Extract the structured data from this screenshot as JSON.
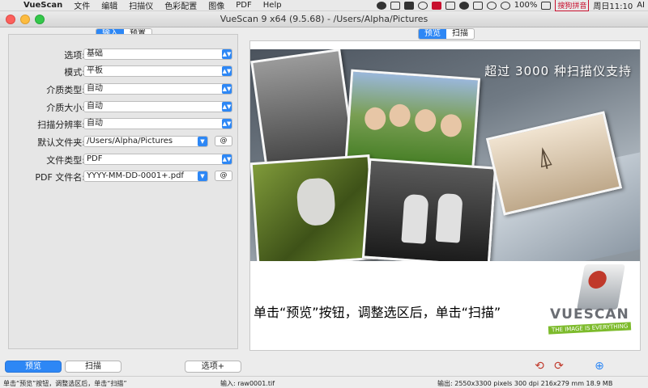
{
  "menubar": {
    "app_name": "VueScan",
    "items": [
      "文件",
      "编辑",
      "扫描仪",
      "色彩配置",
      "图像",
      "PDF",
      "Help"
    ],
    "battery": "100%",
    "ime": "搜狗拼音",
    "clock": "周日11:10",
    "tray_text": "AI"
  },
  "window": {
    "title": "VueScan 9 x64 (9.5.68) - /Users/Alpha/Pictures"
  },
  "left_tabs": [
    {
      "label": "输入",
      "active": true
    },
    {
      "label": "预置",
      "active": false
    }
  ],
  "fields": {
    "option": {
      "label": "选项:",
      "value": "基础"
    },
    "mode": {
      "label": "模式:",
      "value": "平板"
    },
    "media_type": {
      "label": "介质类型:",
      "value": "自动"
    },
    "media_size": {
      "label": "介质大小:",
      "value": "自动"
    },
    "resolution": {
      "label": "扫描分辨率:",
      "value": "自动"
    },
    "default_folder": {
      "label": "默认文件夹:",
      "value": "/Users/Alpha/Pictures",
      "at_label": "@"
    },
    "file_type": {
      "label": "文件类型:",
      "value": "PDF"
    },
    "pdf_name": {
      "label": "PDF 文件名:",
      "value": "YYYY-MM-DD-0001+.pdf",
      "at_label": "@"
    }
  },
  "right_tabs": [
    {
      "label": "预览",
      "active": true
    },
    {
      "label": "扫描",
      "active": false
    }
  ],
  "preview": {
    "caption": "超过 3000 种扫描仪支持",
    "instruction": "单击“预览”按钮，调整选区后，单击“扫描”",
    "logo_word": "VUESCAN",
    "logo_tag": "THE IMAGE IS EVERYTHING"
  },
  "buttons": {
    "preview": "预览",
    "scan": "扫描",
    "options": "选项+"
  },
  "status": {
    "hint": "单击“预览”按钮，调整选区后，单击“扫描”",
    "input": "输入: raw0001.tif",
    "output": "输出: 2550x3300 pixels 300 dpi 216x279 mm 18.9 MB"
  },
  "colors": {
    "accent": "#2d87f5",
    "logo_green": "#7dbb2c"
  }
}
